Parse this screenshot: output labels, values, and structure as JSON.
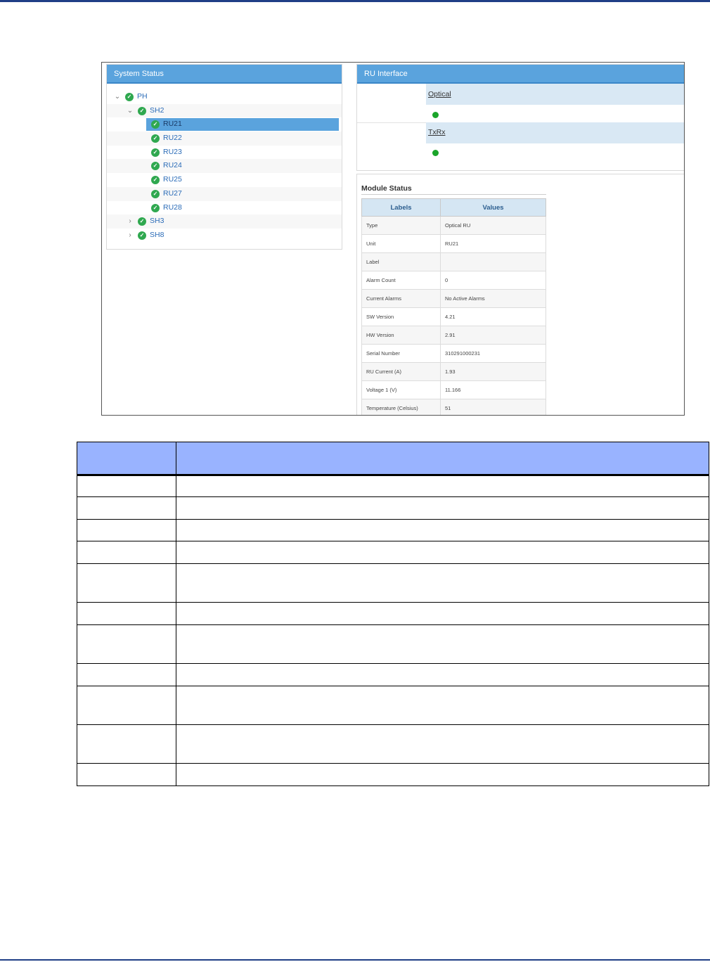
{
  "system_status": {
    "title": "System Status",
    "tree": [
      {
        "label": "PH",
        "level": 0,
        "expanded": true
      },
      {
        "label": "SH2",
        "level": 1,
        "expanded": true
      },
      {
        "label": "RU21",
        "level": 2,
        "selected": true
      },
      {
        "label": "RU22",
        "level": 2
      },
      {
        "label": "RU23",
        "level": 2
      },
      {
        "label": "RU24",
        "level": 2
      },
      {
        "label": "RU25",
        "level": 2
      },
      {
        "label": "RU27",
        "level": 2
      },
      {
        "label": "RU28",
        "level": 2
      },
      {
        "label": "SH3",
        "level": 1,
        "expanded": false
      },
      {
        "label": "SH8",
        "level": 1,
        "expanded": false
      }
    ]
  },
  "ru_interface": {
    "title": "RU Interface",
    "links": [
      "Optical",
      "TxRx"
    ]
  },
  "module_status": {
    "title": "Module Status",
    "headers": [
      "Labels",
      "Values"
    ],
    "rows": [
      [
        "Type",
        "Optical RU"
      ],
      [
        "Unit",
        "RU21"
      ],
      [
        "Label",
        ""
      ],
      [
        "Alarm Count",
        "0"
      ],
      [
        "Current Alarms",
        "No Active Alarms"
      ],
      [
        "SW Version",
        "4.21"
      ],
      [
        "HW Version",
        "2.91"
      ],
      [
        "Serial Number",
        "310291000231"
      ],
      [
        "RU Current (A)",
        "1.93"
      ],
      [
        "Voltage 1 (V)",
        "11.166"
      ],
      [
        "Temperature (Celsius)",
        "51"
      ]
    ]
  },
  "doc_table_row_heights": [
    31,
    32,
    31,
    32,
    55,
    32,
    55,
    32,
    55,
    55,
    32
  ],
  "colors": {
    "panel_header": "#5aa3dd",
    "status_ok": "#2fa84f",
    "doc_header": "#99b3ff",
    "rule": "#1f3e86"
  }
}
